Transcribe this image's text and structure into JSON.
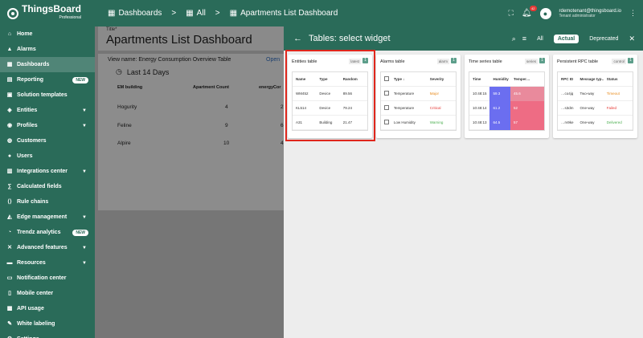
{
  "brand": {
    "name": "ThingsBoard",
    "sub": "Professional"
  },
  "sidebar": {
    "items": [
      {
        "label": "Home",
        "icon": "home-icon",
        "glyph": "⌂"
      },
      {
        "label": "Alarms",
        "icon": "alarm-icon",
        "glyph": "▲"
      },
      {
        "label": "Dashboards",
        "icon": "dashboard-icon",
        "glyph": "▦",
        "active": true
      },
      {
        "label": "Reporting",
        "icon": "report-icon",
        "glyph": "▤",
        "badge": "NEW"
      },
      {
        "label": "Solution templates",
        "icon": "template-icon",
        "glyph": "▣"
      },
      {
        "label": "Entities",
        "icon": "entities-icon",
        "glyph": "◈",
        "chevron": true
      },
      {
        "label": "Profiles",
        "icon": "profiles-icon",
        "glyph": "◉",
        "chevron": true
      },
      {
        "label": "Customers",
        "icon": "customers-icon",
        "glyph": "◍"
      },
      {
        "label": "Users",
        "icon": "users-icon",
        "glyph": "●"
      },
      {
        "label": "Integrations center",
        "icon": "integrations-icon",
        "glyph": "▥",
        "chevron": true
      },
      {
        "label": "Calculated fields",
        "icon": "calc-icon",
        "glyph": "∑"
      },
      {
        "label": "Rule chains",
        "icon": "rule-chain-icon",
        "glyph": "⟨⟩"
      },
      {
        "label": "Edge management",
        "icon": "edge-icon",
        "glyph": "◭",
        "chevron": true
      },
      {
        "label": "Trendz analytics",
        "icon": "trendz-icon",
        "glyph": "◔",
        "badge": "NEW"
      },
      {
        "label": "Advanced features",
        "icon": "advanced-icon",
        "glyph": "✕",
        "chevron": true
      },
      {
        "label": "Resources",
        "icon": "resources-icon",
        "glyph": "▬",
        "chevron": true
      },
      {
        "label": "Notification center",
        "icon": "notification-icon",
        "glyph": "▭"
      },
      {
        "label": "Mobile center",
        "icon": "mobile-icon",
        "glyph": "▯"
      },
      {
        "label": "API usage",
        "icon": "api-icon",
        "glyph": "▩"
      },
      {
        "label": "White labeling",
        "icon": "white-label-icon",
        "glyph": "✎"
      },
      {
        "label": "Settings",
        "icon": "settings-icon",
        "glyph": "⚙"
      }
    ]
  },
  "topbar": {
    "crumbs": [
      "Dashboards",
      "All",
      "Apartments List Dashboard"
    ],
    "separator": ">",
    "notifications": "42",
    "user_email": "rdemotenant@thingsboard.io",
    "user_role": "Tenant administrator"
  },
  "dashboard": {
    "title_label": "Title*",
    "title": "Apartments List Dashboard",
    "view_name": "View name: Energy Consumption Overview Table",
    "open": "Open",
    "period": "Last 14 Days",
    "headers": [
      "EM building",
      "Apartment Count",
      "energyCor"
    ],
    "rows": [
      [
        "Hogurity",
        "4",
        "2"
      ],
      [
        "Feline",
        "9",
        "6"
      ],
      [
        "Alpire",
        "10",
        "4"
      ]
    ]
  },
  "panel": {
    "title": "Tables: select widget",
    "filters": [
      "All",
      "Actual",
      "Deprecated"
    ],
    "active_filter": "Actual",
    "widgets": [
      {
        "title": "Entities table",
        "tag": "latest",
        "count": "1",
        "headers": [
          "Name",
          "Type",
          "Random"
        ],
        "rows": [
          [
            "WM452",
            "Device",
            "89.56"
          ],
          [
            "KL514",
            "Device",
            "79.24"
          ],
          [
            "A31",
            "Building",
            "21.47"
          ]
        ]
      },
      {
        "title": "Alarms table",
        "tag": "alarm",
        "count": "1",
        "headers": [
          "",
          "Type ↓",
          "Severity"
        ],
        "rows": [
          [
            "",
            "Temperature",
            "Major"
          ],
          [
            "",
            "Temperature",
            "Critical"
          ],
          [
            "",
            "Low Humidity",
            "Warning"
          ]
        ],
        "severity_colors": [
          "#e88a1a",
          "#e53935",
          "#4caf50"
        ]
      },
      {
        "title": "Time series table",
        "tag": "series",
        "count": "1",
        "headers": [
          "Time",
          "Humidity",
          "Temper…"
        ],
        "rows": [
          [
            "10:48:15",
            "59.3",
            "45.6"
          ],
          [
            "10:48:14",
            "61.2",
            "52"
          ],
          [
            "10:48:13",
            "64.5",
            "57"
          ]
        ]
      },
      {
        "title": "Persistent RPC table",
        "tag": "control",
        "count": "1",
        "headers": [
          "RPC ID",
          "Message typ…",
          "Status"
        ],
        "rows": [
          [
            "…co4jq",
            "Two-way",
            "Timeout"
          ],
          [
            "…s3dm",
            "One-way",
            "Failed"
          ],
          [
            "…rv9ke",
            "One-way",
            "Delivered"
          ]
        ],
        "status_colors": [
          "#e88a1a",
          "#e53935",
          "#4caf50"
        ]
      }
    ]
  },
  "colors": {
    "brand": "#2a6b59",
    "highlight": "#e0261c"
  }
}
